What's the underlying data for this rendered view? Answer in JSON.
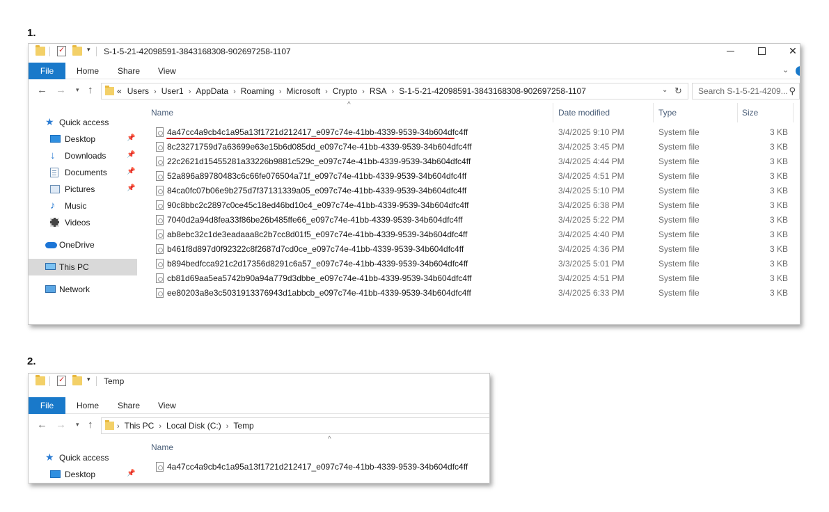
{
  "steps": {
    "one": "1.",
    "two": "2."
  },
  "window1": {
    "title": "S-1-5-21-42098591-3843168308-902697258-1107",
    "controls": {
      "minimize": "",
      "maximize": "",
      "close": "✕"
    },
    "ribbon": {
      "file": "File",
      "home": "Home",
      "share": "Share",
      "view": "View"
    },
    "nav": {
      "back": "←",
      "forward": "→",
      "recent": "⌄",
      "up": "↑"
    },
    "address": {
      "overflow": "«",
      "crumbs": [
        "Users",
        "User1",
        "AppData",
        "Roaming",
        "Microsoft",
        "Crypto",
        "RSA",
        "S-1-5-21-42098591-3843168308-902697258-1107"
      ],
      "separator": "›"
    },
    "search": {
      "placeholder": "Search S-1-5-21-4209..."
    },
    "sidebar": [
      {
        "label": "Quick access",
        "icon": "star-icon"
      },
      {
        "label": "Desktop",
        "icon": "desktop-icon",
        "pinned": true
      },
      {
        "label": "Downloads",
        "icon": "download-icon",
        "pinned": true
      },
      {
        "label": "Documents",
        "icon": "documents-icon",
        "pinned": true
      },
      {
        "label": "Pictures",
        "icon": "pictures-icon",
        "pinned": true
      },
      {
        "label": "Music",
        "icon": "music-icon"
      },
      {
        "label": "Videos",
        "icon": "videos-icon"
      },
      {
        "label": "OneDrive",
        "icon": "cloud-icon"
      },
      {
        "label": "This PC",
        "icon": "computer-icon",
        "selected": true
      },
      {
        "label": "Network",
        "icon": "network-icon"
      }
    ],
    "columns": {
      "name": "Name",
      "date": "Date modified",
      "type": "Type",
      "size": "Size"
    },
    "files": [
      {
        "name": "4a47cc4a9cb4c1a95a13f1721d212417_e097c74e-41bb-4339-9539-34b604dfc4ff",
        "date": "3/4/2025 9:10 PM",
        "type": "System file",
        "size": "3 KB",
        "highlighted": true
      },
      {
        "name": "8c23271759d7a63699e63e15b6d085dd_e097c74e-41bb-4339-9539-34b604dfc4ff",
        "date": "3/4/2025 3:45 PM",
        "type": "System file",
        "size": "3 KB"
      },
      {
        "name": "22c2621d15455281a33226b9881c529c_e097c74e-41bb-4339-9539-34b604dfc4ff",
        "date": "3/4/2025 4:44 PM",
        "type": "System file",
        "size": "3 KB"
      },
      {
        "name": "52a896a89780483c6c66fe076504a71f_e097c74e-41bb-4339-9539-34b604dfc4ff",
        "date": "3/4/2025 4:51 PM",
        "type": "System file",
        "size": "3 KB"
      },
      {
        "name": "84ca0fc07b06e9b275d7f37131339a05_e097c74e-41bb-4339-9539-34b604dfc4ff",
        "date": "3/4/2025 5:10 PM",
        "type": "System file",
        "size": "3 KB"
      },
      {
        "name": "90c8bbc2c2897c0ce45c18ed46bd10c4_e097c74e-41bb-4339-9539-34b604dfc4ff",
        "date": "3/4/2025 6:38 PM",
        "type": "System file",
        "size": "3 KB"
      },
      {
        "name": "7040d2a94d8fea33f86be26b485ffe66_e097c74e-41bb-4339-9539-34b604dfc4ff",
        "date": "3/4/2025 5:22 PM",
        "type": "System file",
        "size": "3 KB"
      },
      {
        "name": "ab8ebc32c1de3eadaaa8c2b7cc8d01f5_e097c74e-41bb-4339-9539-34b604dfc4ff",
        "date": "3/4/2025 4:40 PM",
        "type": "System file",
        "size": "3 KB"
      },
      {
        "name": "b461f8d897d0f92322c8f2687d7cd0ce_e097c74e-41bb-4339-9539-34b604dfc4ff",
        "date": "3/4/2025 4:36 PM",
        "type": "System file",
        "size": "3 KB"
      },
      {
        "name": "b894bedfcca921c2d17356d8291c6a57_e097c74e-41bb-4339-9539-34b604dfc4ff",
        "date": "3/3/2025 5:01 PM",
        "type": "System file",
        "size": "3 KB"
      },
      {
        "name": "cb81d69aa5ea5742b90a94a779d3dbbe_e097c74e-41bb-4339-9539-34b604dfc4ff",
        "date": "3/4/2025 4:51 PM",
        "type": "System file",
        "size": "3 KB"
      },
      {
        "name": "ee80203a8e3c5031913376943d1abbcb_e097c74e-41bb-4339-9539-34b604dfc4ff",
        "date": "3/4/2025 6:33 PM",
        "type": "System file",
        "size": "3 KB"
      }
    ]
  },
  "window2": {
    "title": "Temp",
    "ribbon": {
      "file": "File",
      "home": "Home",
      "share": "Share",
      "view": "View"
    },
    "address": {
      "crumbs": [
        "This PC",
        "Local Disk (C:)",
        "Temp"
      ],
      "separator": "›"
    },
    "sidebar": [
      {
        "label": "Quick access",
        "icon": "star-icon"
      },
      {
        "label": "Desktop",
        "icon": "desktop-icon",
        "pinned": true
      }
    ],
    "columns": {
      "name": "Name"
    },
    "files": [
      {
        "name": "4a47cc4a9cb4c1a95a13f1721d212417_e097c74e-41bb-4339-9539-34b604dfc4ff"
      }
    ]
  },
  "colors": {
    "accent": "#1979ca",
    "highlight_underline": "#cc1f1f",
    "selected_nav": "#d9d9d9"
  }
}
